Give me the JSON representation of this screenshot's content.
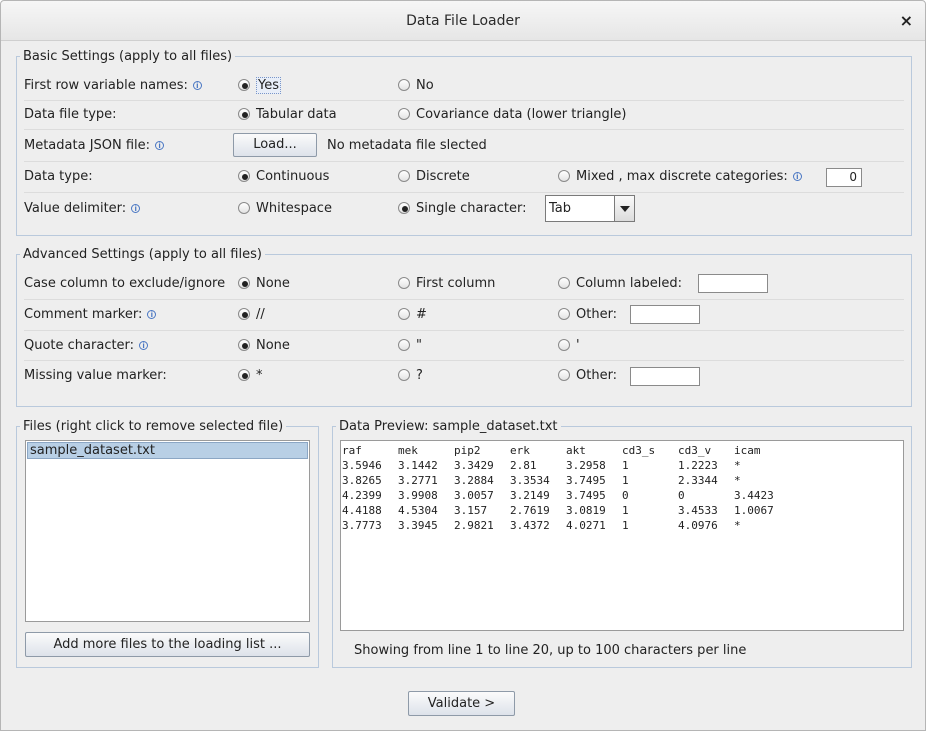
{
  "window": {
    "title": "Data File Loader",
    "close_glyph": "×"
  },
  "basic": {
    "legend": "Basic Settings (apply to all files)",
    "first_row": {
      "label": "First row variable names:",
      "yes": "Yes",
      "no": "No",
      "selected": "Yes"
    },
    "file_type": {
      "label": "Data file type:",
      "tabular": "Tabular data",
      "covariance": "Covariance data (lower triangle)",
      "selected": "Tabular data"
    },
    "metadata": {
      "label": "Metadata JSON file:",
      "button": "Load...",
      "status": "No metadata file slected"
    },
    "data_type": {
      "label": "Data type:",
      "continuous": "Continuous",
      "discrete": "Discrete",
      "mixed": "Mixed , max discrete categories:",
      "max_categories": "0",
      "selected": "Continuous"
    },
    "delimiter": {
      "label": "Value delimiter:",
      "whitespace": "Whitespace",
      "single": "Single character:",
      "combo_value": "Tab",
      "selected": "Single character:"
    }
  },
  "advanced": {
    "legend": "Advanced Settings (apply to all files)",
    "case_column": {
      "label": "Case column to exclude/ignore",
      "none": "None",
      "first": "First column",
      "labeled": "Column labeled:",
      "labeled_value": "",
      "selected": "None"
    },
    "comment": {
      "label": "Comment marker:",
      "slashes": "//",
      "hash": "#",
      "other": "Other:",
      "other_value": "",
      "selected": "//"
    },
    "quote": {
      "label": "Quote character:",
      "none": "None",
      "double": "\"",
      "single": "'",
      "selected": "None"
    },
    "missing": {
      "label": "Missing value marker:",
      "star": "*",
      "question": "?",
      "other": "Other:",
      "other_value": "",
      "selected": "*"
    }
  },
  "files": {
    "legend": "Files (right click to remove selected file)",
    "items": [
      "sample_dataset.txt"
    ],
    "add_button": "Add more files to the loading list ..."
  },
  "preview": {
    "legend": "Data Preview: sample_dataset.txt",
    "rows": [
      [
        "raf",
        "mek",
        "pip2",
        "erk",
        "akt",
        "cd3_s",
        "cd3_v",
        "icam"
      ],
      [
        "3.5946",
        "3.1442",
        "3.3429",
        "2.81",
        "3.2958",
        "1",
        "1.2223",
        "*"
      ],
      [
        "3.8265",
        "3.2771",
        "3.2884",
        "3.3534",
        "3.7495",
        "1",
        "2.3344",
        "*"
      ],
      [
        "4.2399",
        "3.9908",
        "3.0057",
        "3.2149",
        "3.7495",
        "0",
        "0",
        "3.4423"
      ],
      [
        "4.4188",
        "4.5304",
        "3.157",
        "2.7619",
        "3.0819",
        "1",
        "3.4533",
        "1.0067"
      ],
      [
        "3.7773",
        "3.3945",
        "2.9821",
        "3.4372",
        "4.0271",
        "1",
        "4.0976",
        "*"
      ]
    ],
    "footer": "Showing from line 1 to line 20, up to 100 characters per line"
  },
  "actions": {
    "validate": "Validate >"
  }
}
